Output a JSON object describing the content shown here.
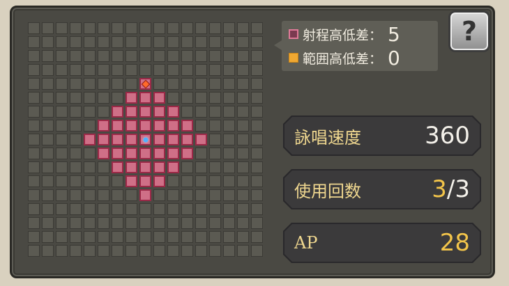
{
  "legend": {
    "range_height_label": "射程高低差：",
    "range_height_value": "5",
    "area_height_label": "範囲高低差：",
    "area_height_value": "0",
    "range_color": "#cf6f87",
    "area_color": "#f0a832"
  },
  "help_button": {
    "label": "?"
  },
  "stats": {
    "cast_speed": {
      "label": "詠唱速度",
      "value": "360"
    },
    "uses": {
      "label": "使用回数",
      "current": "3",
      "separator": "/",
      "max": "3"
    },
    "ap": {
      "label": "AP",
      "value": "28"
    }
  },
  "grid": {
    "size": 17,
    "center": [
      8,
      8
    ],
    "range_radius": 4,
    "target": [
      8,
      4
    ],
    "caster_icon": "caster-dot-icon",
    "target_icon": "target-diamond-icon"
  }
}
